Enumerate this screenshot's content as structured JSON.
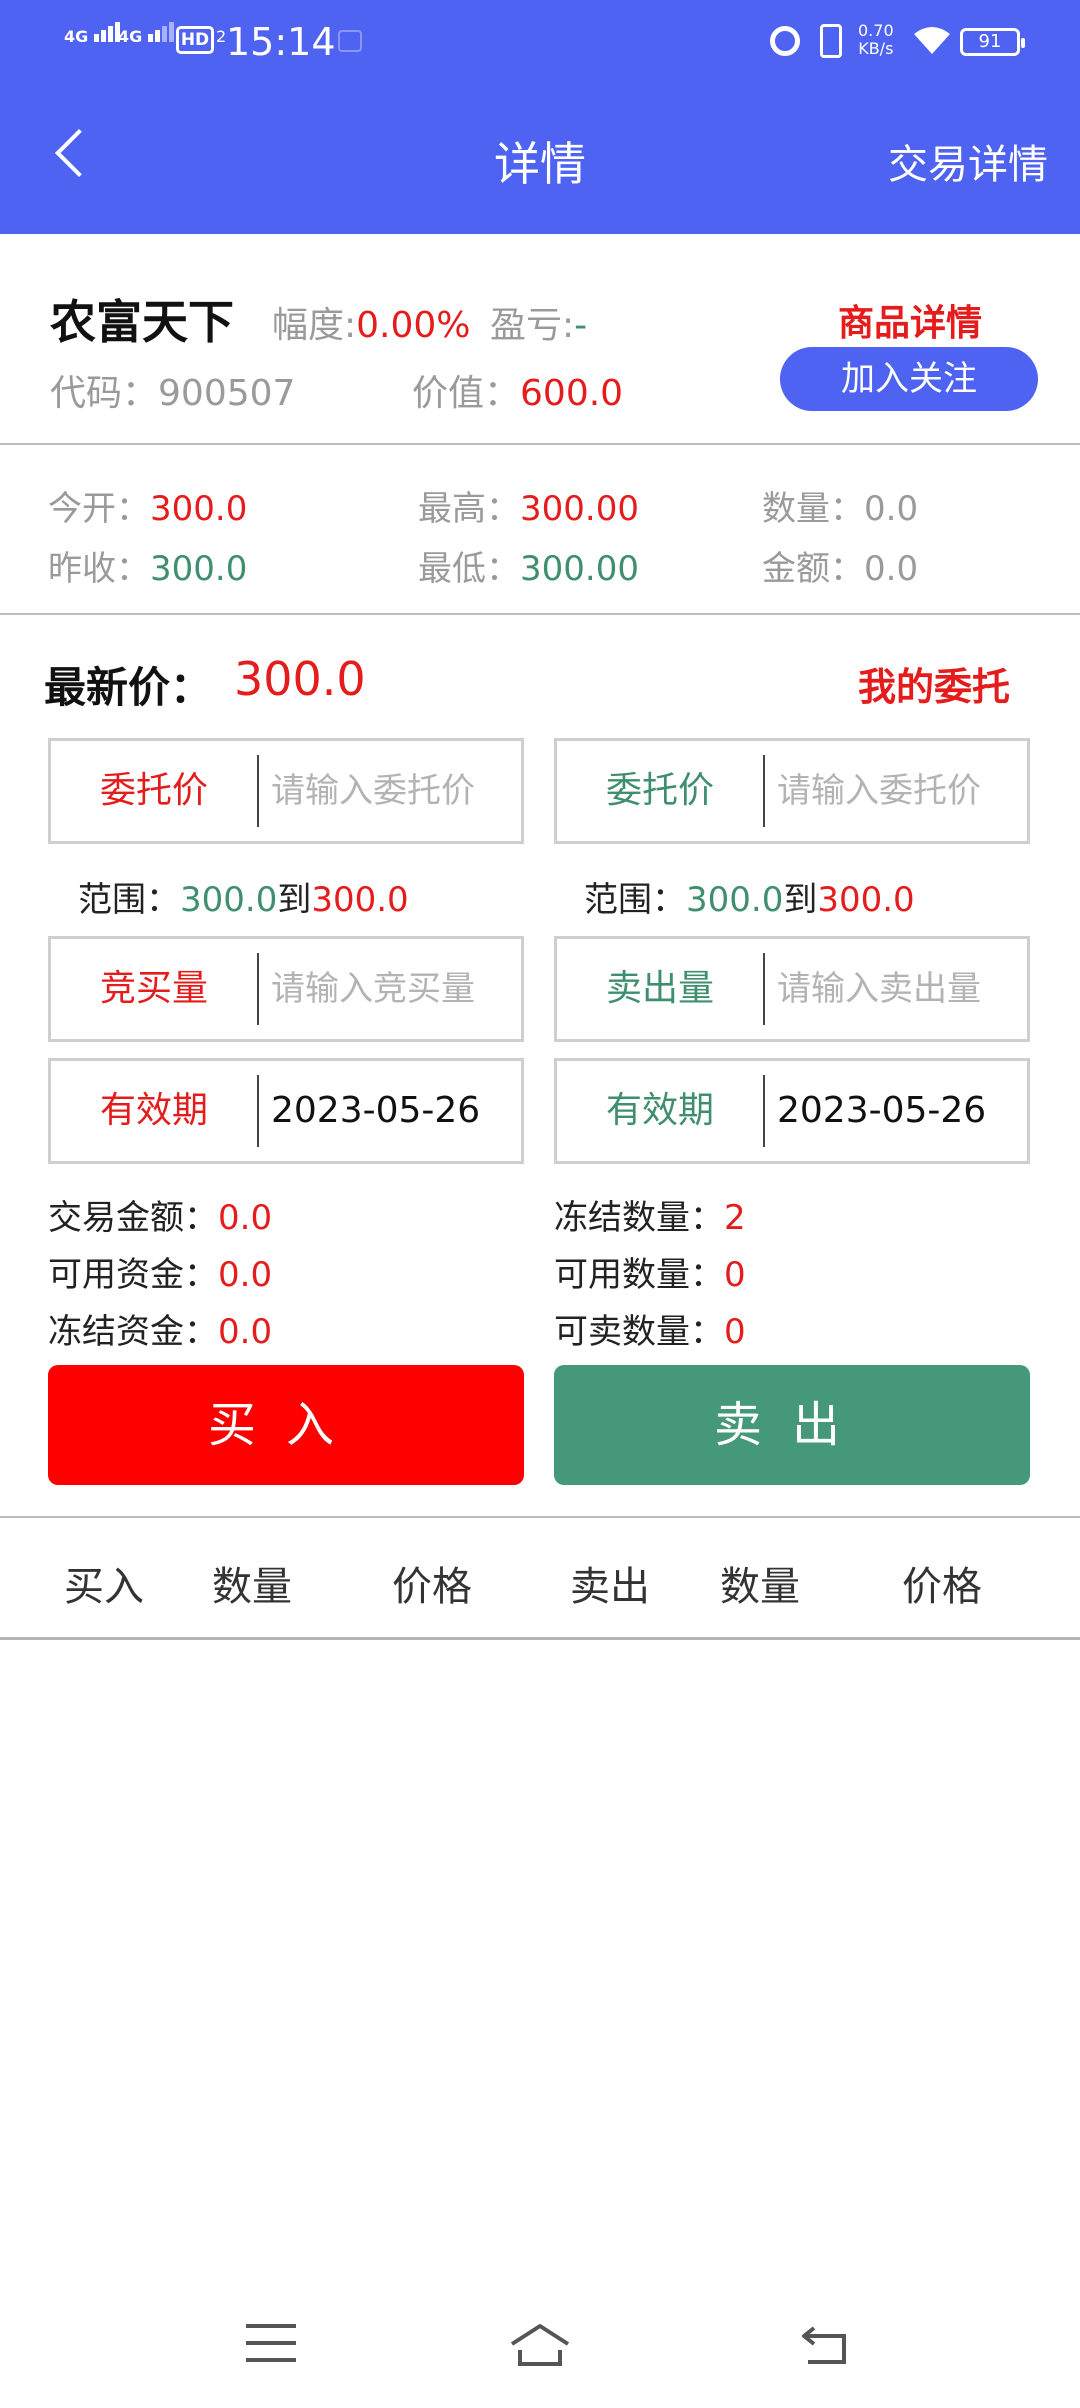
{
  "status_bar": {
    "time": "15:14",
    "net1": "4G",
    "net2": "4G",
    "hd": "HD",
    "hd_sub": "2",
    "speed_value": "0.70",
    "speed_unit": "KB/s",
    "battery": "91"
  },
  "header": {
    "title": "详情",
    "right_link": "交易详情"
  },
  "product": {
    "name": "农富天下",
    "range_label": "幅度:",
    "range_value": "0.00%",
    "pnl_label": "盈亏:",
    "pnl_value": "-",
    "code_label": "代码：",
    "code_value": "900507",
    "value_label": "价值：",
    "value_value": "600.0",
    "detail_link": "商品详情",
    "follow_button": "加入关注"
  },
  "market": {
    "open_label": "今开：",
    "open_value": "300.0",
    "high_label": "最高：",
    "high_value": "300.00",
    "qty_label": "数量：",
    "qty_value": "0.0",
    "prev_label": "昨收：",
    "prev_value": "300.0",
    "low_label": "最低：",
    "low_value": "300.00",
    "amount_label": "金额：",
    "amount_value": "0.0"
  },
  "latest": {
    "label": "最新价：",
    "value": "300.0",
    "my_orders": "我的委托"
  },
  "buy": {
    "price_label": "委托价",
    "price_placeholder": "请输入委托价",
    "range_label": "范围：",
    "range_from": "300.0",
    "range_to_word": "到",
    "range_to": "300.0",
    "qty_label": "竞买量",
    "qty_placeholder": "请输入竞买量",
    "valid_label": "有效期",
    "valid_value": "2023-05-26",
    "trade_amount_label": "交易金额：",
    "trade_amount_value": "0.0",
    "avail_funds_label": "可用资金：",
    "avail_funds_value": "0.0",
    "frozen_funds_label": "冻结资金：",
    "frozen_funds_value": "0.0",
    "button": "买入"
  },
  "sell": {
    "price_label": "委托价",
    "price_placeholder": "请输入委托价",
    "range_label": "范围：",
    "range_from": "300.0",
    "range_to_word": "到",
    "range_to": "300.0",
    "qty_label": "卖出量",
    "qty_placeholder": "请输入卖出量",
    "valid_label": "有效期",
    "valid_value": "2023-05-26",
    "frozen_qty_label": "冻结数量：",
    "frozen_qty_value": "2",
    "avail_qty_label": "可用数量：",
    "avail_qty_value": "0",
    "sellable_qty_label": "可卖数量：",
    "sellable_qty_value": "0",
    "button": "卖出"
  },
  "order_table": {
    "columns": [
      "买入",
      "数量",
      "价格",
      "卖出",
      "数量",
      "价格"
    ]
  },
  "colors": {
    "header_bg": "#4f63f2",
    "red": "#e51c1c",
    "green": "#3f8f6d",
    "buy_button": "#ff0000",
    "sell_button": "#459879"
  },
  "icons": {
    "back": "chevron-left-icon",
    "menu": "menu-icon",
    "home": "home-icon",
    "return": "return-icon"
  }
}
